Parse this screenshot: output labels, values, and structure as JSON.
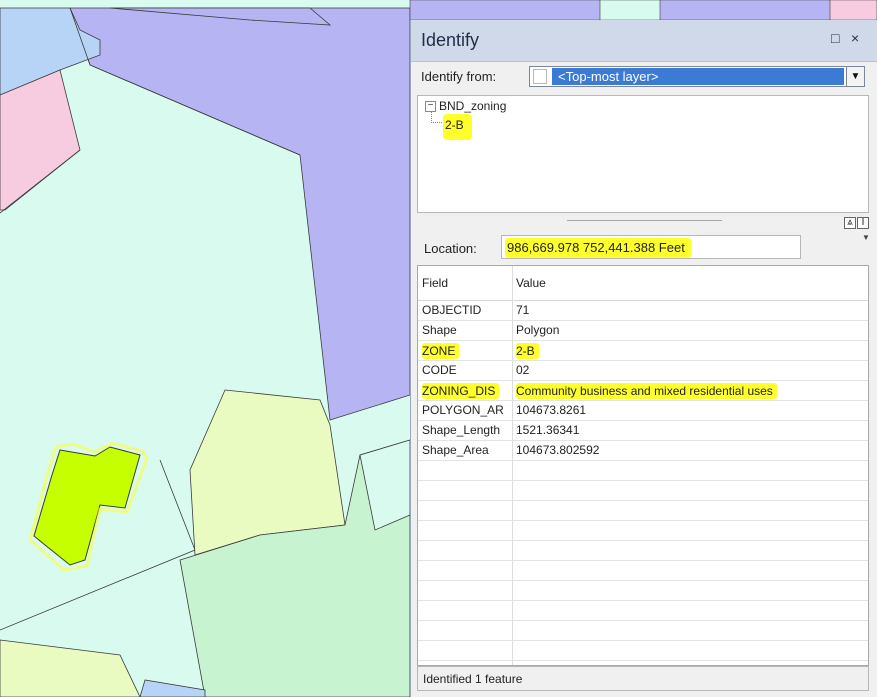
{
  "window": {
    "title": "Identify",
    "restore_glyph": "□",
    "close_glyph": "×"
  },
  "identify_from": {
    "label": "Identify from:",
    "value": "<Top-most layer>",
    "arrow_glyph": "▼"
  },
  "tree": {
    "layer": "BND_zoning",
    "feature": "2-B",
    "expander_glyph": "−"
  },
  "splitter": {
    "btn_expand": "⩓",
    "btn_split": "I"
  },
  "location": {
    "label": "Location:",
    "value": "986,669.978  752,441.388 Feet",
    "dropdown_glyph": "▼"
  },
  "table": {
    "headers": [
      "Field",
      "Value"
    ],
    "rows": [
      {
        "field": "OBJECTID",
        "value": "71",
        "highlight": false
      },
      {
        "field": "Shape",
        "value": "Polygon",
        "highlight": false
      },
      {
        "field": "ZONE",
        "value": "2-B",
        "highlight": true
      },
      {
        "field": "CODE",
        "value": "02",
        "highlight": false
      },
      {
        "field": "ZONING_DIS",
        "value": "Community business and mixed residential uses",
        "highlight": true
      },
      {
        "field": "POLYGON_AR",
        "value": "104673.8261",
        "highlight": false
      },
      {
        "field": "Shape_Length",
        "value": "1521.36341",
        "highlight": false
      },
      {
        "field": "Shape_Area",
        "value": "104673.802592",
        "highlight": false
      }
    ]
  },
  "status": "Identified 1 feature",
  "colors": {
    "highlight": "#ffff2b",
    "selected_feature": "#c6ff00",
    "zone_purple": "#b7b4f3",
    "zone_lightcyan": "#d9fbef",
    "zone_pink": "#f7cbe0",
    "zone_blue": "#b7d4f7",
    "zone_green": "#c8f3d1",
    "zone_yellowgreen": "#eafbc2"
  }
}
